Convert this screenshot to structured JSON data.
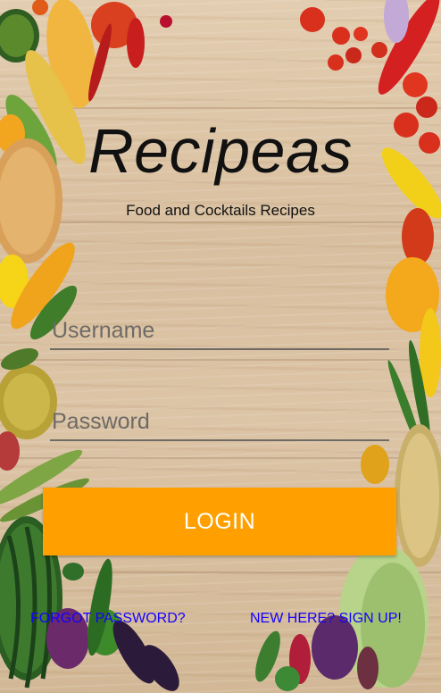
{
  "app": {
    "title": "Recipeas",
    "subtitle": "Food and Cocktails Recipes"
  },
  "login_form": {
    "username_placeholder": "Username",
    "password_placeholder": "Password",
    "login_label": "LOGIN"
  },
  "links": {
    "forgot_password": "FORGOT PASSWORD?",
    "sign_up": "NEW HERE? SIGN UP!"
  },
  "colors": {
    "accent": "#ffa000",
    "link": "#1400ff",
    "title": "#111111"
  },
  "icons": {
    "background": "vegetables-on-wood-image"
  }
}
